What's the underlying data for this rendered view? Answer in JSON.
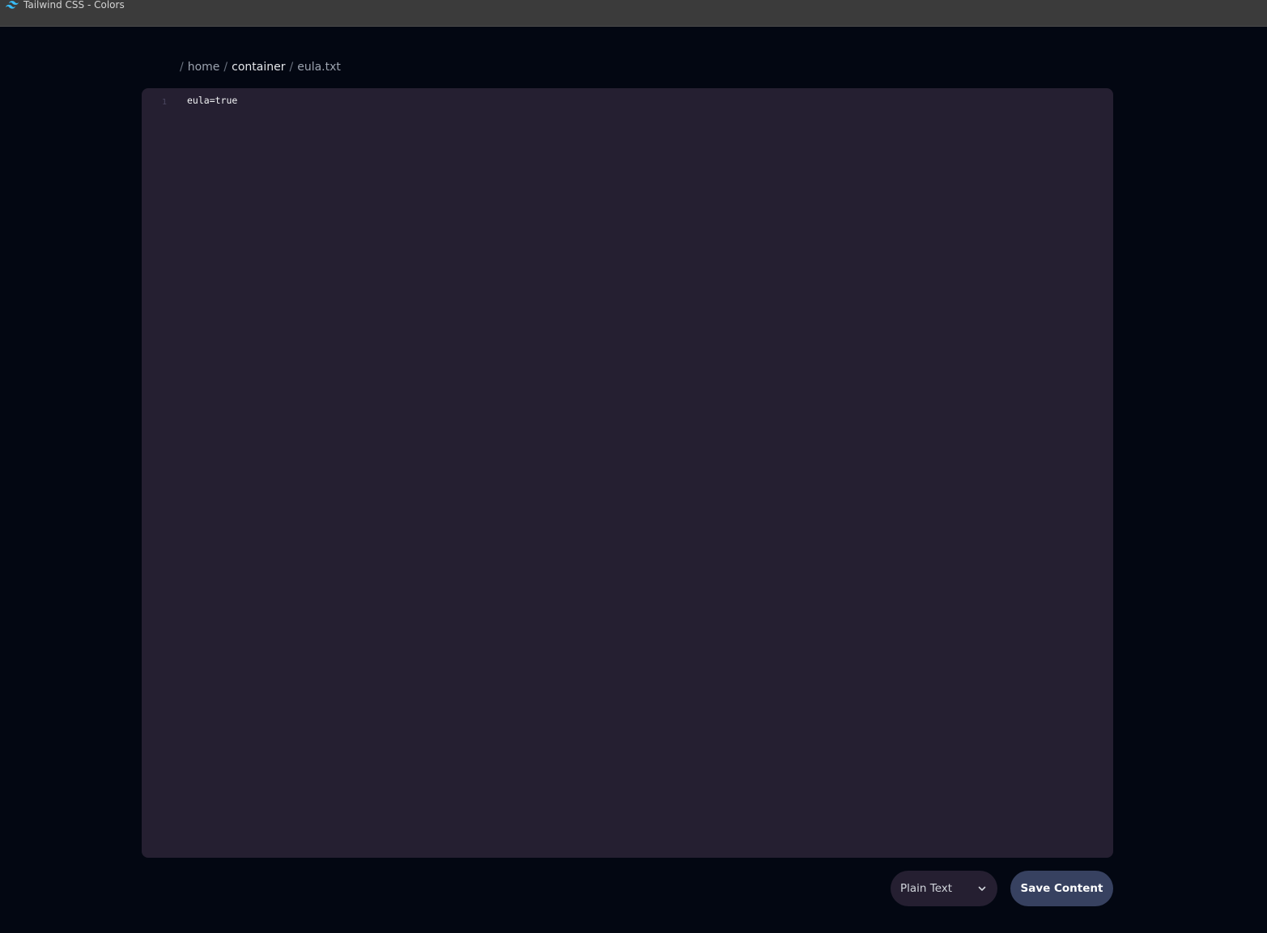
{
  "window": {
    "title": "Tailwind CSS - Colors",
    "icon": "tailwind-logo-icon"
  },
  "breadcrumb": {
    "items": [
      {
        "label": "home"
      },
      {
        "label": "container"
      },
      {
        "label": "eula.txt"
      }
    ],
    "separator": "/"
  },
  "editor": {
    "lines": [
      {
        "number": "1",
        "text": "eula=true"
      }
    ]
  },
  "footer": {
    "language_select": {
      "selected": "Plain Text",
      "icon": "chevron-down-icon"
    },
    "save_label": "Save Content"
  },
  "colors": {
    "background": "#030712",
    "editor_bg": "#251f31",
    "button_bg": "#374160",
    "accent_logo": "#38bdf8"
  }
}
